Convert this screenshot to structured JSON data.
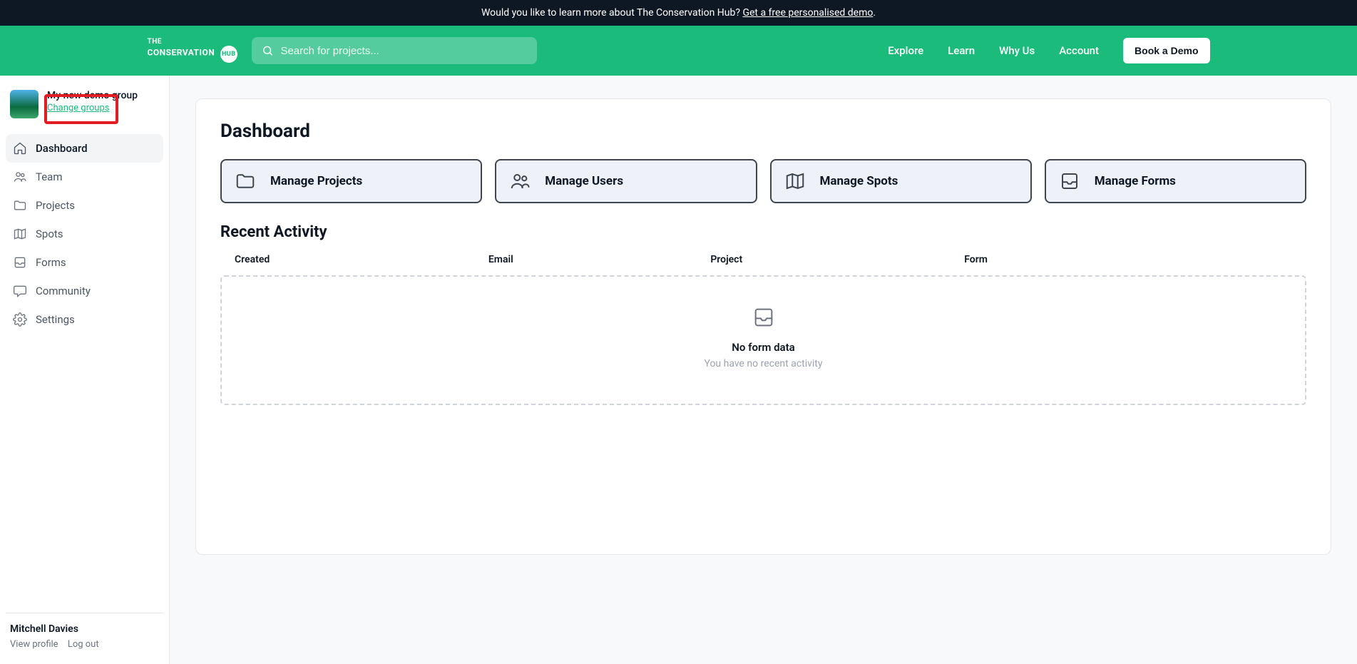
{
  "banner": {
    "text": "Would you like to learn more about The Conservation Hub? ",
    "link": "Get a free personalised demo",
    "suffix": "."
  },
  "logo": {
    "line1": "THE",
    "line2": "CONSERVATION",
    "hub": "HUB"
  },
  "search": {
    "placeholder": "Search for projects..."
  },
  "nav": {
    "explore": "Explore",
    "learn": "Learn",
    "why": "Why Us",
    "account": "Account",
    "demo": "Book a Demo"
  },
  "sidebar": {
    "group_name": "My new demo group",
    "change_groups": "Change groups",
    "items": [
      {
        "label": "Dashboard"
      },
      {
        "label": "Team"
      },
      {
        "label": "Projects"
      },
      {
        "label": "Spots"
      },
      {
        "label": "Forms"
      },
      {
        "label": "Community"
      },
      {
        "label": "Settings"
      }
    ],
    "footer": {
      "user": "Mitchell Davies",
      "view_profile": "View profile",
      "logout": "Log out"
    }
  },
  "page": {
    "title": "Dashboard",
    "tiles": {
      "projects": "Manage Projects",
      "users": "Manage Users",
      "spots": "Manage Spots",
      "forms": "Manage Forms"
    },
    "recent_title": "Recent Activity",
    "columns": {
      "created": "Created",
      "email": "Email",
      "project": "Project",
      "form": "Form"
    },
    "empty": {
      "title": "No form data",
      "sub": "You have no recent activity"
    }
  }
}
